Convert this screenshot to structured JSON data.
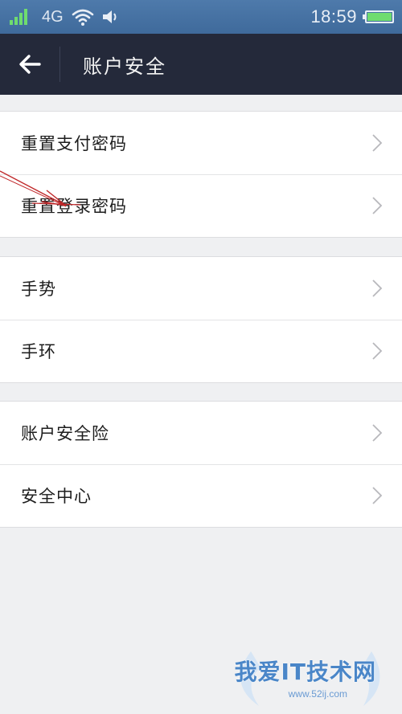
{
  "status_bar": {
    "network": "4G",
    "time": "18:59",
    "icons": [
      "signal-icon",
      "wifi-icon",
      "volume-icon",
      "battery-icon"
    ]
  },
  "header": {
    "title": "账户安全",
    "back_icon": "back-arrow-icon"
  },
  "groups": [
    {
      "items": [
        {
          "label": "重置支付密码"
        },
        {
          "label": "重置登录密码"
        }
      ]
    },
    {
      "items": [
        {
          "label": "手势"
        },
        {
          "label": "手环"
        }
      ]
    },
    {
      "items": [
        {
          "label": "账户安全险"
        },
        {
          "label": "安全中心"
        }
      ]
    }
  ],
  "watermark": {
    "text": "我爱IT技术网",
    "url": "www.52ij.com"
  },
  "colors": {
    "status_bar": "#456f9f",
    "title_bar": "#24293a",
    "background": "#eff0f2",
    "signal_green": "#6fdc6f",
    "annotation_red": "#c0282a"
  }
}
